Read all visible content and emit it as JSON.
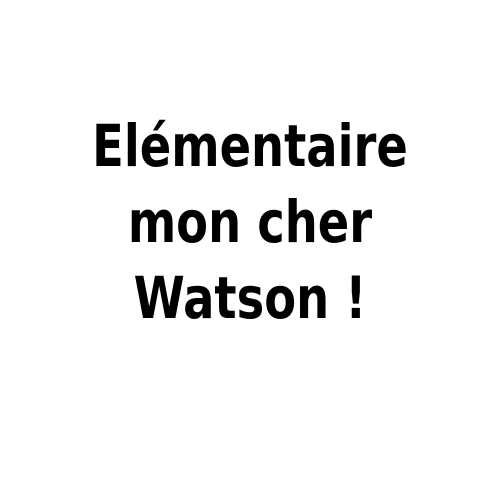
{
  "text": {
    "lines": [
      "Elémentaire",
      "mon cher",
      "Watson !"
    ],
    "color": "#000000"
  },
  "background_color": "#ffffff"
}
